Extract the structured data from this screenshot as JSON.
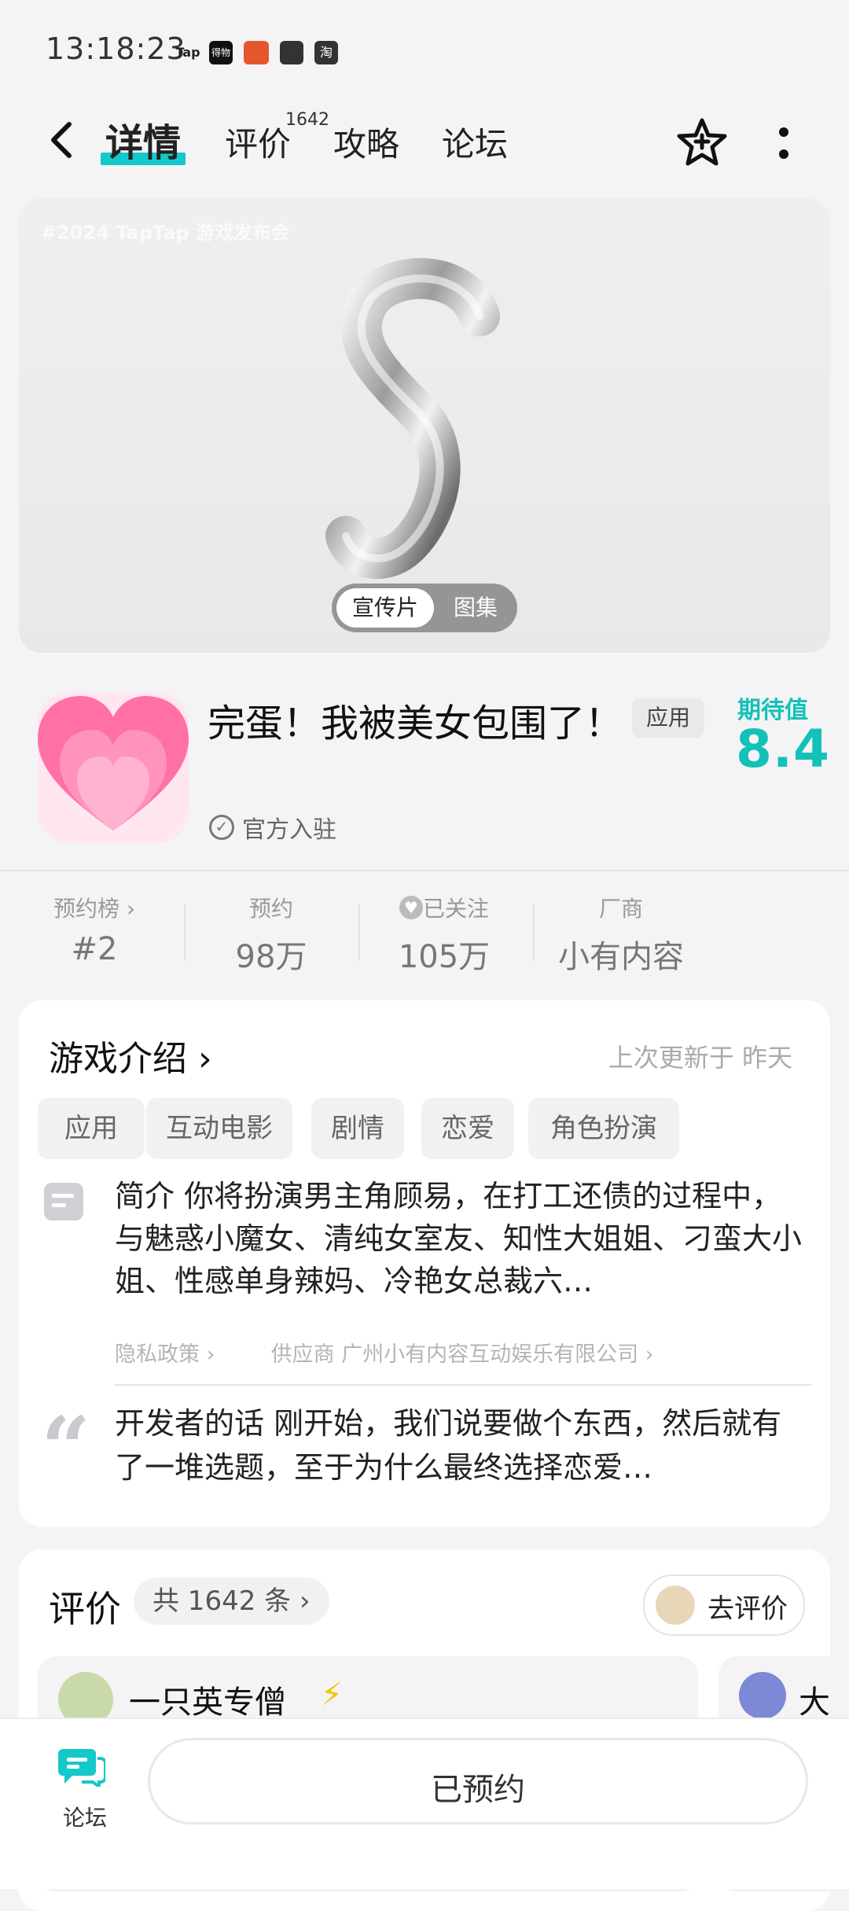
{
  "status_bar": {
    "time": "13:18:23",
    "icons": [
      "Tap",
      "得物",
      "淘"
    ]
  },
  "header": {
    "tabs": [
      "详情",
      "评价",
      "攻略",
      "论坛"
    ],
    "reviews_badge": "1642"
  },
  "media": {
    "watermark": "#2024 TapTap 游戏发布会",
    "toggle_video": "宣传片",
    "toggle_gallery": "图集"
  },
  "app": {
    "title": "完蛋！我被美女包围了！",
    "tag": "应用",
    "expect_label": "期待值",
    "expect_value": "8.4",
    "official": "官方入驻"
  },
  "stats": [
    {
      "label": "预约榜 ›",
      "value": "#2"
    },
    {
      "label": "预约",
      "value": "98万"
    },
    {
      "label": "已关注",
      "value": "105万"
    },
    {
      "label": "厂商",
      "value": "小有内容"
    }
  ],
  "intro": {
    "title": "游戏介绍 ›",
    "updated": "上次更新于 昨天",
    "chips": [
      "应用",
      "互动电影",
      "剧情",
      "恋爱",
      "角色扮演"
    ],
    "brief_label": "简介",
    "brief_text": "你将扮演男主角顾易，在打工还债的过程中，与魅惑小魔女、清纯女室友、知性大姐姐、刁蛮大小姐、性感单身辣妈、冷艳女总裁六…",
    "privacy": "隐私政策 ›",
    "supplier": "供应商 广州小有内容互动娱乐有限公司 ›",
    "dev_label": "开发者的话",
    "dev_text": "刚开始，我们说要做个东西，然后就有了一堆选题，至于为什么最终选择恋爱…"
  },
  "reviews": {
    "title": "评价",
    "count": "共 1642 条 ›",
    "go_review": "去评价",
    "reviewer1": "一只英专僧",
    "reviewer2": "大"
  },
  "bottom": {
    "forum_label": "论坛",
    "reserve_label": "已预约"
  },
  "colors": {
    "accent": "#14c9c9",
    "expect": "#14c1b8"
  }
}
